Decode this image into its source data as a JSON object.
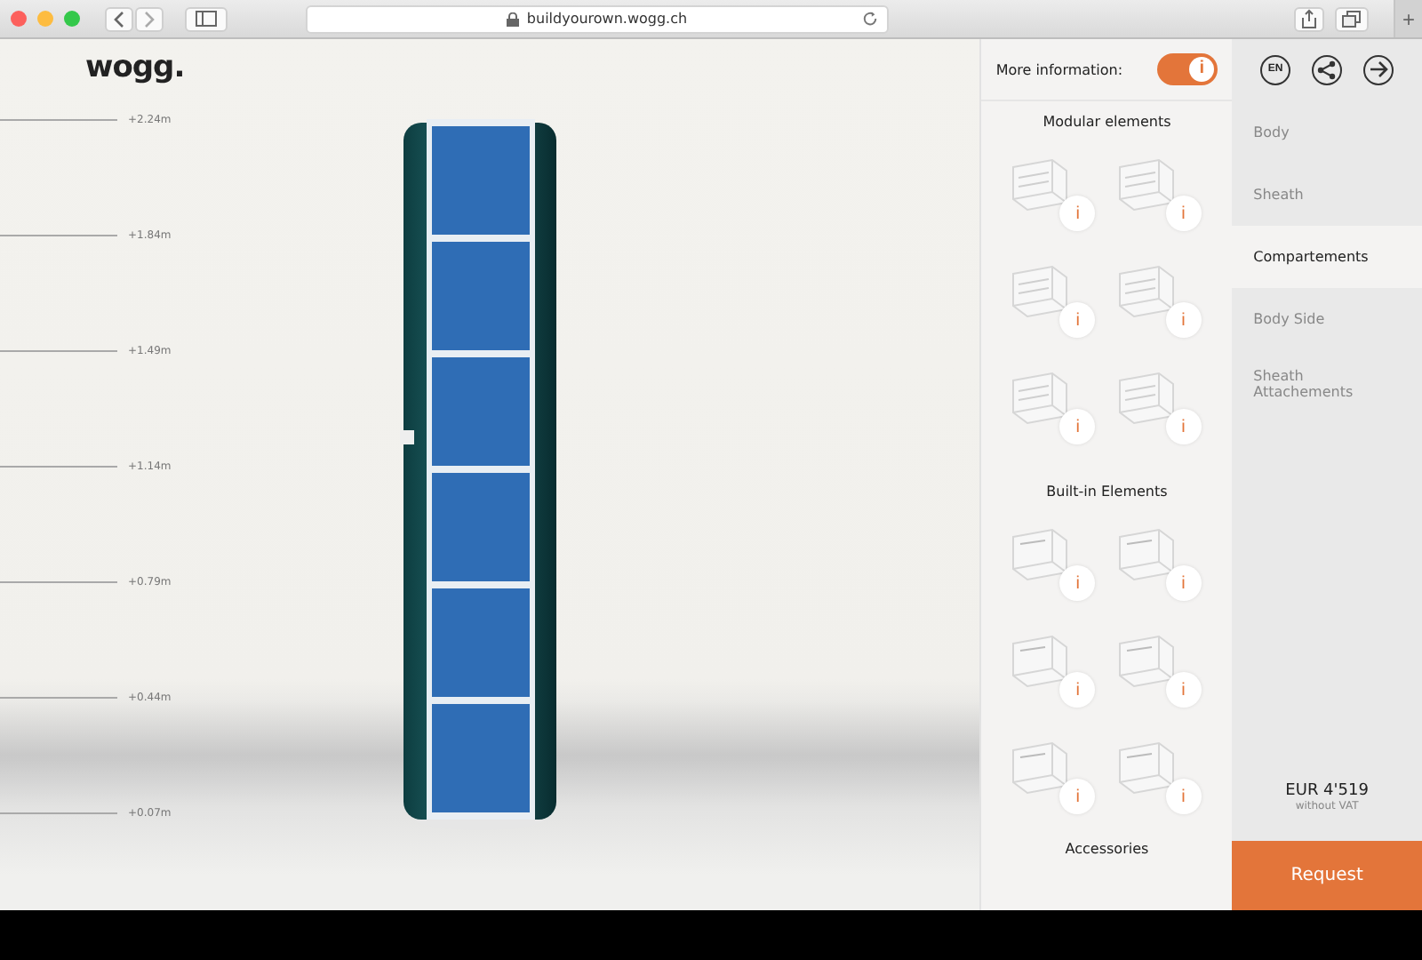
{
  "browser": {
    "url": "buildyourown.wogg.ch",
    "new_tab": "+"
  },
  "logo": "wogg.",
  "height_markers": [
    "+2.24m",
    "+1.84m",
    "+1.49m",
    "+1.14m",
    "+0.79m",
    "+0.44m",
    "+0.07m"
  ],
  "info_toggle": {
    "label": "More information:",
    "on": true,
    "glyph": "i"
  },
  "sections": [
    {
      "title": "Modular elements",
      "items": [
        {
          "info": "i"
        },
        {
          "info": "i"
        },
        {
          "info": "i"
        },
        {
          "info": "i"
        },
        {
          "info": "i"
        },
        {
          "info": "i"
        }
      ]
    },
    {
      "title": "Built-in Elements",
      "items": [
        {
          "info": "i"
        },
        {
          "info": "i"
        },
        {
          "info": "i"
        },
        {
          "info": "i"
        },
        {
          "info": "i"
        },
        {
          "info": "i"
        }
      ]
    },
    {
      "title": "Accessories"
    }
  ],
  "language": "EN",
  "nav": [
    {
      "label": "Body",
      "selected": false
    },
    {
      "label": "Sheath",
      "selected": false
    },
    {
      "label": "Compartements",
      "selected": true
    },
    {
      "label": "Body Side",
      "selected": false
    },
    {
      "label": "Sheath Attachements",
      "selected": false
    }
  ],
  "price": {
    "amount": "EUR 4'519",
    "note": "without VAT"
  },
  "request_button": "Request"
}
